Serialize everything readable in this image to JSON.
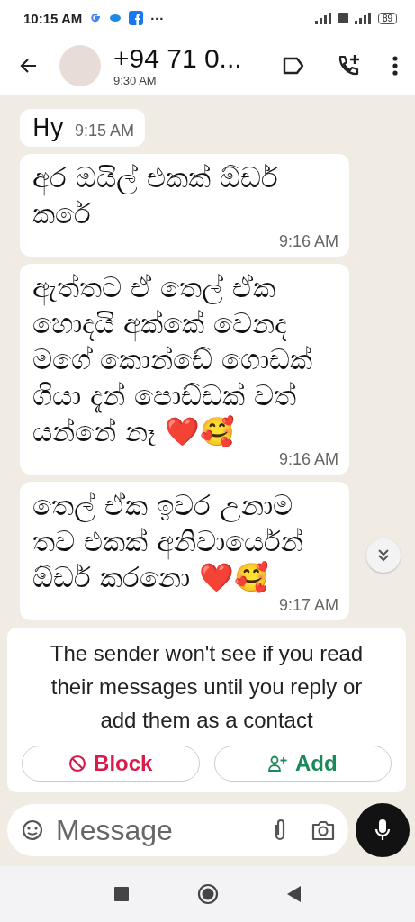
{
  "status_bar": {
    "time": "10:15 AM",
    "more": "···",
    "battery": "89"
  },
  "header": {
    "title": "+94 71 0...",
    "subtitle": "9:30 AM"
  },
  "messages": [
    {
      "text": "Hy",
      "time": "9:15 AM"
    },
    {
      "text": "අර ඔයිල් එකක් ඕඩර් කරේ",
      "time": "9:16 AM"
    },
    {
      "text": "ඇත්තට ඒ තෙල් ඒක හොදයි අක්කේ වෙනද මගේ කොන්ඩේ ගොඩක් ගියා දැන් පොඩ්ඩක් වත් යන්නේ නෑ ❤️🥰",
      "time": "9:16 AM"
    },
    {
      "text": "තෙල් ඒක ඉවර උනාම තව එකක් අනිවාර්යෙන් ඕඩර් කරනො ❤️🥰",
      "time": "9:17 AM"
    }
  ],
  "notice": {
    "text": "The sender won't see if you read their messages until you reply or add them as a contact",
    "buttons": [
      {
        "kind": "block",
        "label": "Block"
      },
      {
        "kind": "add",
        "label": "Add"
      }
    ]
  },
  "composer": {
    "placeholder": "Message"
  }
}
